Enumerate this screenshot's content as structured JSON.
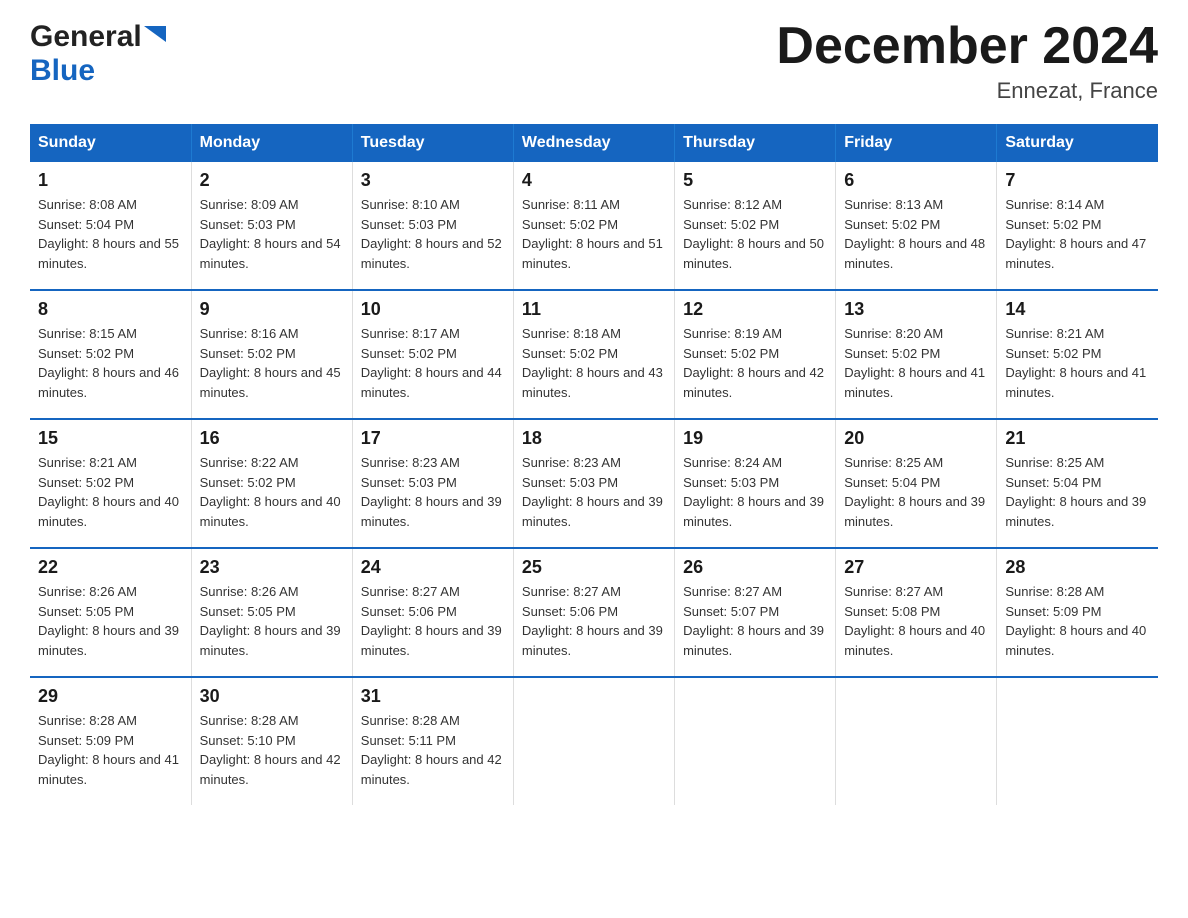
{
  "header": {
    "logo_general": "General",
    "logo_blue": "Blue",
    "month_title": "December 2024",
    "location": "Ennezat, France"
  },
  "days_of_week": [
    "Sunday",
    "Monday",
    "Tuesday",
    "Wednesday",
    "Thursday",
    "Friday",
    "Saturday"
  ],
  "weeks": [
    [
      {
        "num": "1",
        "sunrise": "8:08 AM",
        "sunset": "5:04 PM",
        "daylight": "8 hours and 55 minutes."
      },
      {
        "num": "2",
        "sunrise": "8:09 AM",
        "sunset": "5:03 PM",
        "daylight": "8 hours and 54 minutes."
      },
      {
        "num": "3",
        "sunrise": "8:10 AM",
        "sunset": "5:03 PM",
        "daylight": "8 hours and 52 minutes."
      },
      {
        "num": "4",
        "sunrise": "8:11 AM",
        "sunset": "5:02 PM",
        "daylight": "8 hours and 51 minutes."
      },
      {
        "num": "5",
        "sunrise": "8:12 AM",
        "sunset": "5:02 PM",
        "daylight": "8 hours and 50 minutes."
      },
      {
        "num": "6",
        "sunrise": "8:13 AM",
        "sunset": "5:02 PM",
        "daylight": "8 hours and 48 minutes."
      },
      {
        "num": "7",
        "sunrise": "8:14 AM",
        "sunset": "5:02 PM",
        "daylight": "8 hours and 47 minutes."
      }
    ],
    [
      {
        "num": "8",
        "sunrise": "8:15 AM",
        "sunset": "5:02 PM",
        "daylight": "8 hours and 46 minutes."
      },
      {
        "num": "9",
        "sunrise": "8:16 AM",
        "sunset": "5:02 PM",
        "daylight": "8 hours and 45 minutes."
      },
      {
        "num": "10",
        "sunrise": "8:17 AM",
        "sunset": "5:02 PM",
        "daylight": "8 hours and 44 minutes."
      },
      {
        "num": "11",
        "sunrise": "8:18 AM",
        "sunset": "5:02 PM",
        "daylight": "8 hours and 43 minutes."
      },
      {
        "num": "12",
        "sunrise": "8:19 AM",
        "sunset": "5:02 PM",
        "daylight": "8 hours and 42 minutes."
      },
      {
        "num": "13",
        "sunrise": "8:20 AM",
        "sunset": "5:02 PM",
        "daylight": "8 hours and 41 minutes."
      },
      {
        "num": "14",
        "sunrise": "8:21 AM",
        "sunset": "5:02 PM",
        "daylight": "8 hours and 41 minutes."
      }
    ],
    [
      {
        "num": "15",
        "sunrise": "8:21 AM",
        "sunset": "5:02 PM",
        "daylight": "8 hours and 40 minutes."
      },
      {
        "num": "16",
        "sunrise": "8:22 AM",
        "sunset": "5:02 PM",
        "daylight": "8 hours and 40 minutes."
      },
      {
        "num": "17",
        "sunrise": "8:23 AM",
        "sunset": "5:03 PM",
        "daylight": "8 hours and 39 minutes."
      },
      {
        "num": "18",
        "sunrise": "8:23 AM",
        "sunset": "5:03 PM",
        "daylight": "8 hours and 39 minutes."
      },
      {
        "num": "19",
        "sunrise": "8:24 AM",
        "sunset": "5:03 PM",
        "daylight": "8 hours and 39 minutes."
      },
      {
        "num": "20",
        "sunrise": "8:25 AM",
        "sunset": "5:04 PM",
        "daylight": "8 hours and 39 minutes."
      },
      {
        "num": "21",
        "sunrise": "8:25 AM",
        "sunset": "5:04 PM",
        "daylight": "8 hours and 39 minutes."
      }
    ],
    [
      {
        "num": "22",
        "sunrise": "8:26 AM",
        "sunset": "5:05 PM",
        "daylight": "8 hours and 39 minutes."
      },
      {
        "num": "23",
        "sunrise": "8:26 AM",
        "sunset": "5:05 PM",
        "daylight": "8 hours and 39 minutes."
      },
      {
        "num": "24",
        "sunrise": "8:27 AM",
        "sunset": "5:06 PM",
        "daylight": "8 hours and 39 minutes."
      },
      {
        "num": "25",
        "sunrise": "8:27 AM",
        "sunset": "5:06 PM",
        "daylight": "8 hours and 39 minutes."
      },
      {
        "num": "26",
        "sunrise": "8:27 AM",
        "sunset": "5:07 PM",
        "daylight": "8 hours and 39 minutes."
      },
      {
        "num": "27",
        "sunrise": "8:27 AM",
        "sunset": "5:08 PM",
        "daylight": "8 hours and 40 minutes."
      },
      {
        "num": "28",
        "sunrise": "8:28 AM",
        "sunset": "5:09 PM",
        "daylight": "8 hours and 40 minutes."
      }
    ],
    [
      {
        "num": "29",
        "sunrise": "8:28 AM",
        "sunset": "5:09 PM",
        "daylight": "8 hours and 41 minutes."
      },
      {
        "num": "30",
        "sunrise": "8:28 AM",
        "sunset": "5:10 PM",
        "daylight": "8 hours and 42 minutes."
      },
      {
        "num": "31",
        "sunrise": "8:28 AM",
        "sunset": "5:11 PM",
        "daylight": "8 hours and 42 minutes."
      },
      {
        "num": "",
        "sunrise": "",
        "sunset": "",
        "daylight": ""
      },
      {
        "num": "",
        "sunrise": "",
        "sunset": "",
        "daylight": ""
      },
      {
        "num": "",
        "sunrise": "",
        "sunset": "",
        "daylight": ""
      },
      {
        "num": "",
        "sunrise": "",
        "sunset": "",
        "daylight": ""
      }
    ]
  ]
}
